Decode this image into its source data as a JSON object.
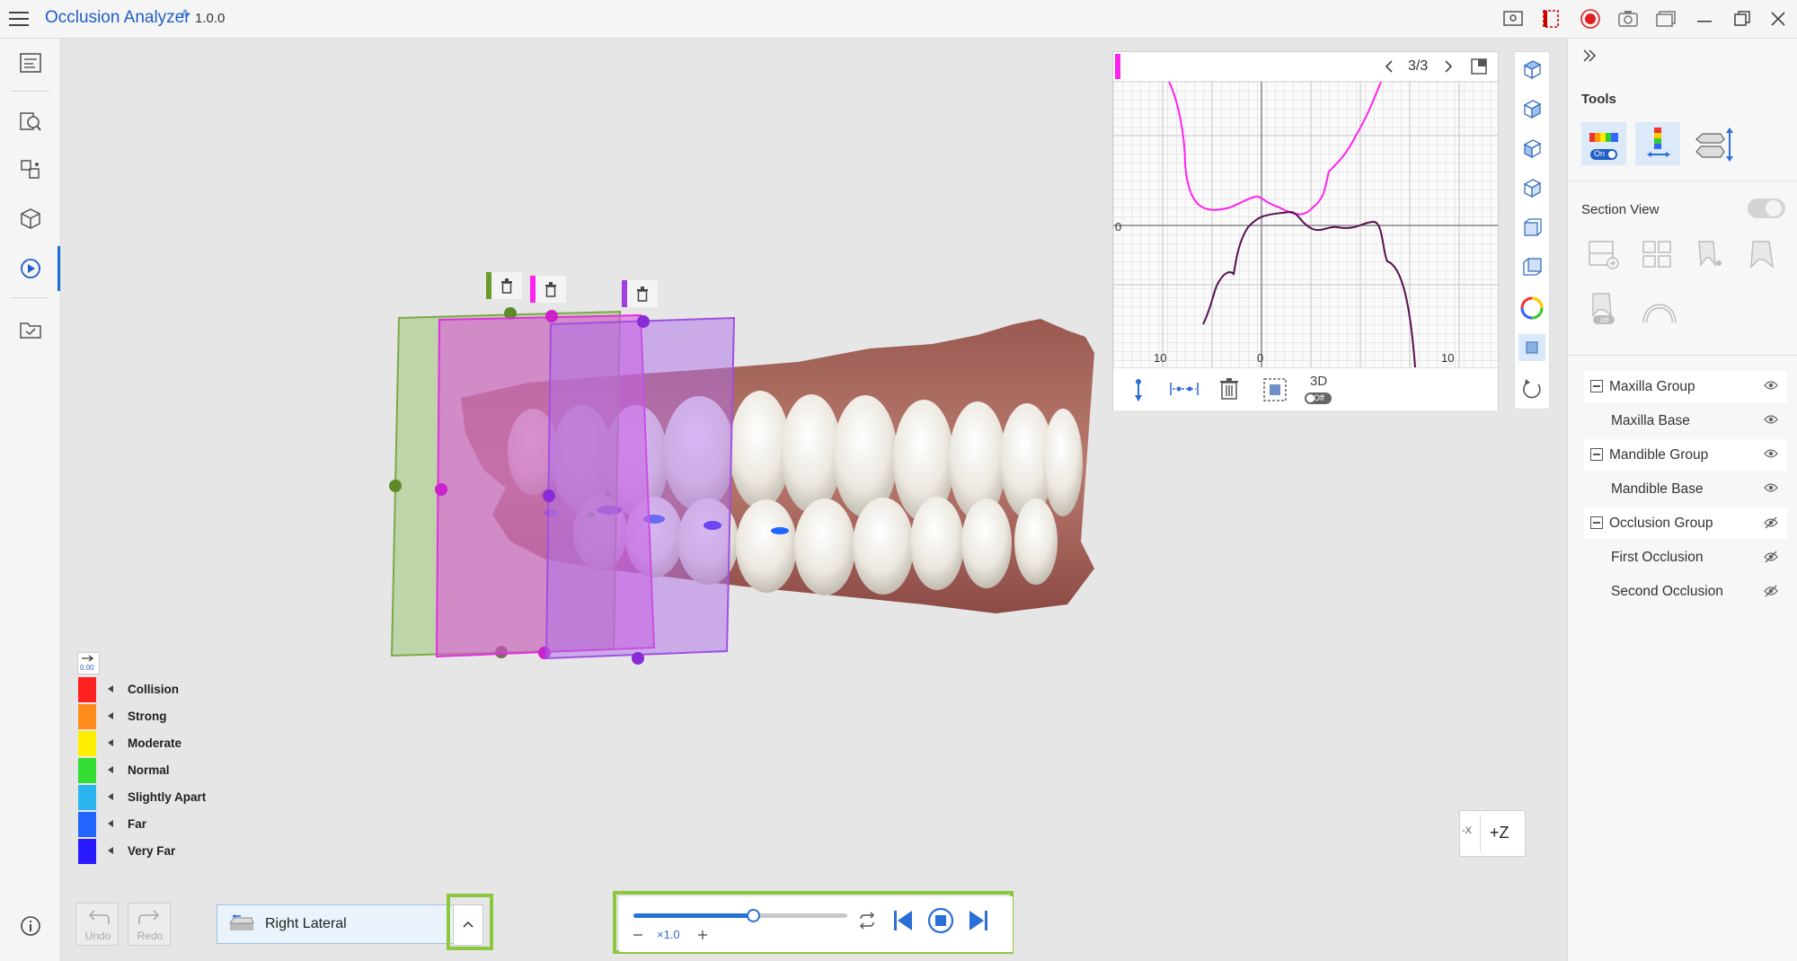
{
  "app": {
    "title": "Occlusion Analyzer",
    "version": "1.0.0"
  },
  "graph": {
    "page": "3/3",
    "y_tick": "0",
    "x_ticks": [
      "10",
      "0",
      "10"
    ],
    "toolbar_3d": "3D",
    "toolbar_3d_state": "Off",
    "series_colors": [
      "#ff22ee",
      "#55104f"
    ]
  },
  "right_panel": {
    "tools_title": "Tools",
    "tool_on_label": "On",
    "section_view_label": "Section View",
    "section_off_label": "Off",
    "layers": [
      {
        "label": "Maxilla Group",
        "group": true,
        "visible": true
      },
      {
        "label": "Maxilla Base",
        "group": false,
        "visible": true
      },
      {
        "label": "Mandible Group",
        "group": true,
        "visible": true
      },
      {
        "label": "Mandible Base",
        "group": false,
        "visible": true
      },
      {
        "label": "Occlusion Group",
        "group": true,
        "visible": false
      },
      {
        "label": "First Occlusion",
        "group": false,
        "visible": false
      },
      {
        "label": "Second Occlusion",
        "group": false,
        "visible": false
      }
    ]
  },
  "legend": {
    "scale_value": "0.00",
    "items": [
      {
        "label": "Collision",
        "color": "#ff2020"
      },
      {
        "label": "Strong",
        "color": "#ff8c1a"
      },
      {
        "label": "Moderate",
        "color": "#ffee00"
      },
      {
        "label": "Normal",
        "color": "#33dd33"
      },
      {
        "label": "Slightly Apart",
        "color": "#2ab4f0"
      },
      {
        "label": "Far",
        "color": "#2266ff"
      },
      {
        "label": "Very Far",
        "color": "#2a1aff"
      }
    ]
  },
  "axis_button": {
    "minus": "-X",
    "plus": "+Z"
  },
  "bottom": {
    "undo": "Undo",
    "redo": "Redo",
    "view_select": "Right Lateral",
    "speed": "×1.0",
    "progress": 0.56
  },
  "section_planes": [
    {
      "color": "#6a9a2a"
    },
    {
      "color": "#ff22ee"
    },
    {
      "color": "#a040e0"
    }
  ]
}
